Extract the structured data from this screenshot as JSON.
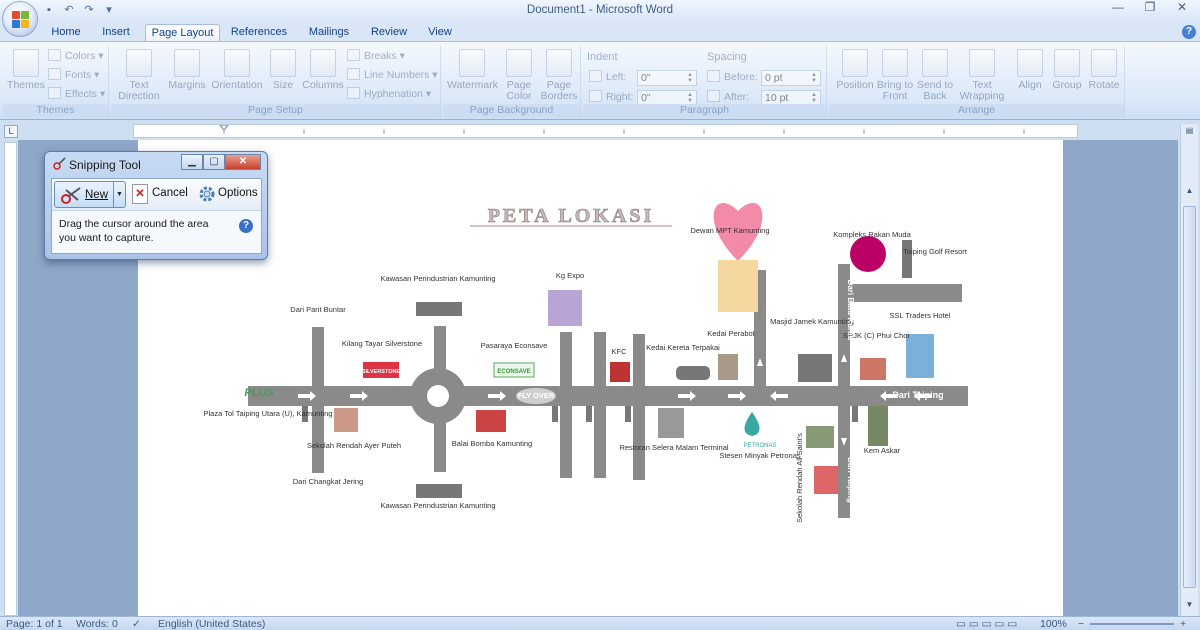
{
  "window": {
    "title": "Document1 - Microsoft Word"
  },
  "tabs": [
    {
      "label": "Home"
    },
    {
      "label": "Insert"
    },
    {
      "label": "Page Layout"
    },
    {
      "label": "References"
    },
    {
      "label": "Mailings"
    },
    {
      "label": "Review"
    },
    {
      "label": "View"
    }
  ],
  "ribbon": {
    "themes": {
      "themes_btn": "Themes",
      "colors": "Colors",
      "fonts": "Fonts",
      "effects": "Effects",
      "label": "Themes"
    },
    "page_setup": {
      "text_direction": "Text Direction",
      "margins": "Margins",
      "orientation": "Orientation",
      "size": "Size",
      "columns": "Columns",
      "breaks": "Breaks",
      "line_numbers": "Line Numbers",
      "hyphenation": "Hyphenation",
      "label": "Page Setup"
    },
    "page_background": {
      "watermark": "Watermark",
      "page_color": "Page Color",
      "page_borders": "Page Borders",
      "label": "Page Background"
    },
    "paragraph": {
      "indent_title": "Indent",
      "left_label": "Left:",
      "left_value": "0\"",
      "right_label": "Right:",
      "right_value": "0\"",
      "spacing_title": "Spacing",
      "before_label": "Before:",
      "before_value": "0 pt",
      "after_label": "After:",
      "after_value": "10 pt",
      "label": "Paragraph"
    },
    "arrange": {
      "position": "Position",
      "bring_to_front": "Bring to Front",
      "send_to_back": "Send to Back",
      "text_wrapping": "Text Wrapping",
      "align": "Align",
      "group": "Group",
      "rotate": "Rotate",
      "label": "Arrange"
    }
  },
  "snipping_tool": {
    "title": "Snipping Tool",
    "new_label": "New",
    "cancel_label": "Cancel",
    "options_label": "Options",
    "message": "Drag the cursor around the area you want to capture."
  },
  "map": {
    "title": "PETA LOKASI",
    "labels": {
      "dewan": "Dewan MPT Kamunting",
      "kompleks": "Kompleks Rakan Muda",
      "golf": "Taiping Golf Resort",
      "dari_batu_kurau": "Dari Batu Kurau",
      "kg_expo": "Kg Expo",
      "kawasan_top": "Kawasan Perindustrian Kamunting",
      "dari_parit_buntar": "Dari Parit Buntar",
      "kilang": "Kilang Tayar Silverstone",
      "silverstone_sign": "SILVERSTONE",
      "pasaraya": "Pasaraya Econsave",
      "econsave_sign": "ECONSAVE",
      "kfc": "KFC",
      "kedai_kereta": "Kedai Kereta Terpakai",
      "kedai_perabot": "Kedai Perabot",
      "masjid": "Masjid Jamek Kamunting",
      "srjk": "SRJK (C) Phui Choi",
      "ssl": "SSL Traders Hotel",
      "plus": "PLUS",
      "plaza_tol": "Plaza Tol Taiping Utara (U), Kamunting",
      "fly_over": "FLY OVER",
      "dari_taiping": "Dari Taiping",
      "sekolah_ayer": "Sekolah Rendah Ayer Puteh",
      "balai_bomba": "Balai Bomba Kamunting",
      "restoran": "Restoran Selera Malam Terminal",
      "petronas": "Stesen Minyak Petronas",
      "petronas_logo": "PETRONAS",
      "kem_askar": "Kem Askar",
      "sekolah_all_saints": "Sekolah Rendah All Saint's",
      "dari_taiping_v": "Dari Taiping",
      "dari_changkat": "Dari Changkat Jering",
      "kawasan_bottom": "Kawasan Perindustrian Kamunting"
    }
  },
  "status": {
    "page": "Page: 1 of 1",
    "words": "Words: 0",
    "language": "English (United States)",
    "zoom": "100%"
  }
}
